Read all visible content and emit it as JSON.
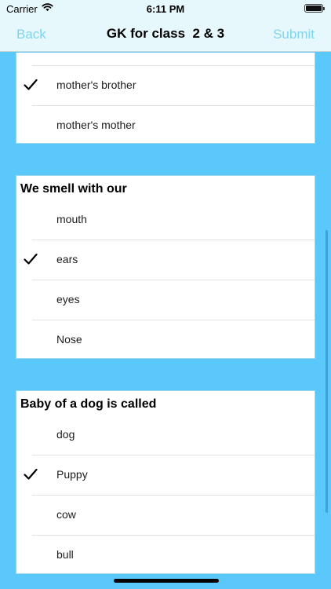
{
  "status_bar": {
    "carrier": "Carrier",
    "time": "6:11 PM"
  },
  "nav": {
    "back": "Back",
    "title": "GK for class  2 & 3",
    "submit": "Submit"
  },
  "card1": {
    "options": [
      {
        "label": "mother's brother",
        "checked": true
      },
      {
        "label": "mother's mother",
        "checked": false
      }
    ]
  },
  "card2": {
    "question": "We smell with our",
    "options": [
      {
        "label": "mouth",
        "checked": false
      },
      {
        "label": "ears",
        "checked": true
      },
      {
        "label": "eyes",
        "checked": false
      },
      {
        "label": "Nose",
        "checked": false
      }
    ]
  },
  "card3": {
    "question": "Baby of a dog is called",
    "options": [
      {
        "label": "dog",
        "checked": false
      },
      {
        "label": "Puppy",
        "checked": true
      },
      {
        "label": "cow",
        "checked": false
      },
      {
        "label": "bull",
        "checked": false
      }
    ]
  },
  "icons": {
    "checkmark": "check-icon",
    "wifi": "wifi-icon",
    "battery": "battery-icon"
  }
}
